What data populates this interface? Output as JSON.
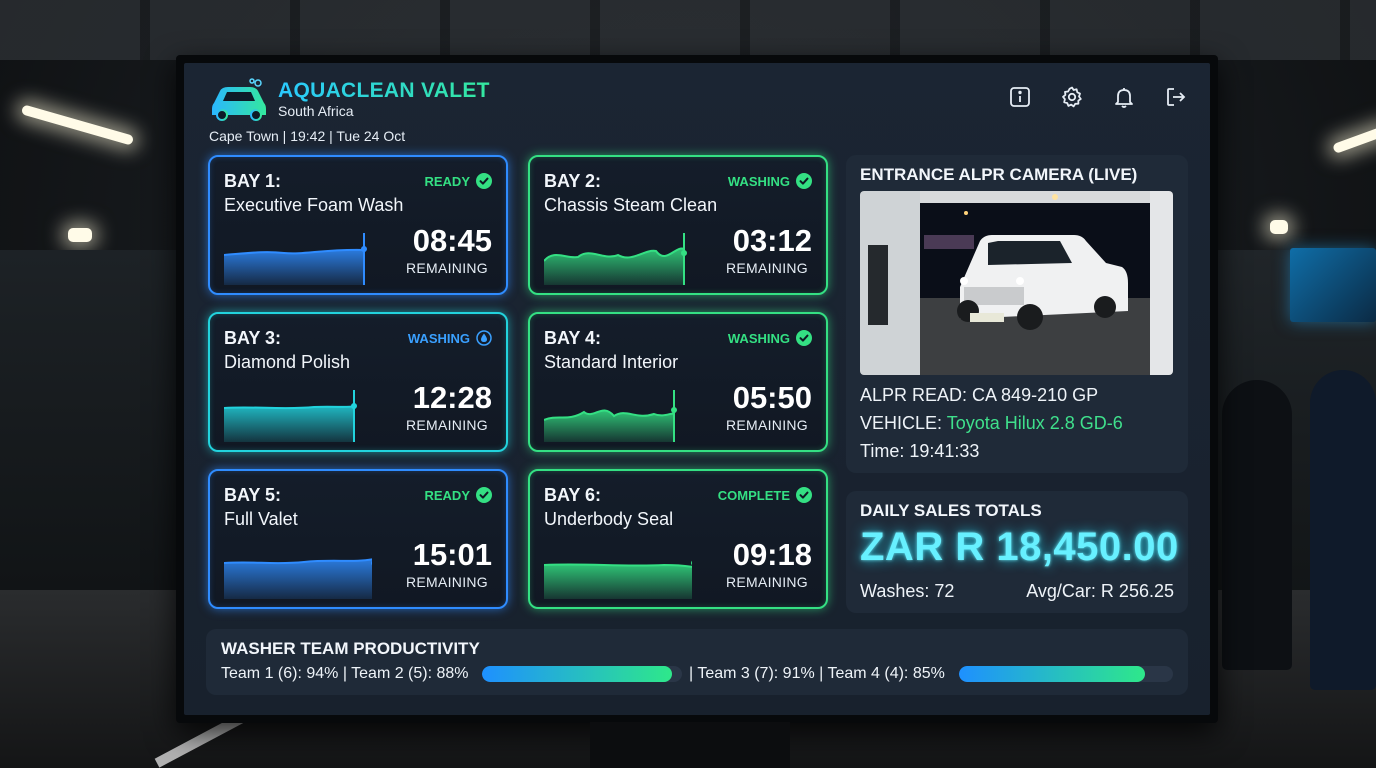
{
  "header": {
    "brand_title": "AQUACLEAN VALET",
    "brand_subtitle": "South Africa",
    "location_line": "Cape Town | 19:42 | Tue 24 Oct",
    "icons": [
      "info-icon",
      "gear-icon",
      "bell-icon",
      "logout-icon"
    ]
  },
  "bays": [
    {
      "title": "BAY 1:",
      "name": "Executive Foam Wash",
      "status": "READY",
      "status_icon": "check-icon",
      "time": "08:45",
      "remaining": "REMAINING",
      "accent": "#2f8cff",
      "status_color": "#34e083",
      "progress": 0.92
    },
    {
      "title": "BAY 2:",
      "name": "Chassis Steam Clean",
      "status": "WASHING",
      "status_icon": "check-icon",
      "time": "03:12",
      "remaining": "REMAINING",
      "accent": "#34e083",
      "status_color": "#34e083",
      "progress": 0.9
    },
    {
      "title": "BAY 3:",
      "name": "Diamond Polish",
      "status": "WASHING",
      "status_icon": "droplet-icon",
      "time": "12:28",
      "remaining": "REMAINING",
      "accent": "#22d3dd",
      "status_color": "#3aa0ff",
      "progress": 0.88
    },
    {
      "title": "BAY 4:",
      "name": "Standard Interior",
      "status": "WASHING",
      "status_icon": "check-icon",
      "time": "05:50",
      "remaining": "REMAINING",
      "accent": "#34e083",
      "status_color": "#34e083",
      "progress": 0.85
    },
    {
      "title": "BAY 5:",
      "name": "Full Valet",
      "status": "READY",
      "status_icon": "check-icon",
      "time": "15:01",
      "remaining": "REMAINING",
      "accent": "#2f8cff",
      "status_color": "#34e083",
      "progress": 0.97
    },
    {
      "title": "BAY 6:",
      "name": "Underbody Seal",
      "status": "COMPLETE",
      "status_icon": "check-icon",
      "time": "09:18",
      "remaining": "REMAINING",
      "accent": "#34e083",
      "status_color": "#34e083",
      "progress": 0.96
    }
  ],
  "alpr": {
    "title": "ENTRANCE ALPR CAMERA (LIVE)",
    "read": "ALPR READ: CA 849-210 GP",
    "vehicle_label": "VEHICLE: ",
    "vehicle_value": "Toyota Hilux 2.8 GD-6",
    "time": "Time: 19:41:33"
  },
  "sales": {
    "title": "DAILY SALES TOTALS",
    "total": "ZAR R 18,450.00",
    "washes": "Washes: 72",
    "avg": "Avg/Car: R 256.25"
  },
  "team": {
    "title": "WASHER TEAM PRODUCTIVITY",
    "left_text": "Team 1 (6): 94% | Team 2 (5): 88%",
    "right_text": "| Team 3 (7): 91% | Team 4 (4): 85%",
    "bar1_progress": 0.95,
    "bar2_progress": 0.87
  }
}
